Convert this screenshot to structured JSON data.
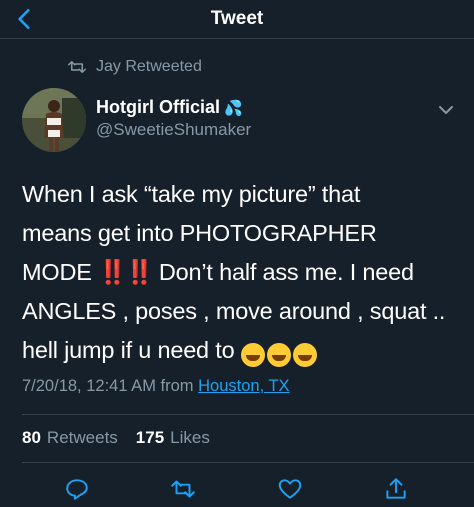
{
  "header": {
    "title": "Tweet",
    "back_icon": "chevron-left-icon"
  },
  "retweet": {
    "icon": "retweet-icon",
    "label": "Jay Retweeted"
  },
  "author": {
    "display_name": "Hotgirl Official",
    "badge_emoji": "💦",
    "handle": "@SweetieShumaker"
  },
  "tweet": {
    "line1": "When I ask “take my picture” that",
    "line2": "means get into PHOTOGRAPHER",
    "line3_before": "MODE ",
    "line3_emoji": "‼️‼️",
    "line3_after": " Don’t half ass me. I need",
    "line4": "ANGLES , poses , move around , squat ..",
    "line5": "hell jump if u need to ",
    "line5_emojis": [
      "🤣",
      "😂",
      "😂"
    ]
  },
  "meta": {
    "timestamp": "7/20/18, 12:41 AM from",
    "location": "Houston, TX"
  },
  "stats": {
    "retweets_count": "80",
    "retweets_label": "Retweets",
    "likes_count": "175",
    "likes_label": "Likes"
  },
  "actions": [
    "reply-icon",
    "retweet-icon",
    "like-icon",
    "share-icon"
  ],
  "colors": {
    "background": "#15202b",
    "muted": "#8899a6",
    "link": "#1da1f2",
    "divider": "#38444d",
    "accent_red": "#e0245e"
  }
}
